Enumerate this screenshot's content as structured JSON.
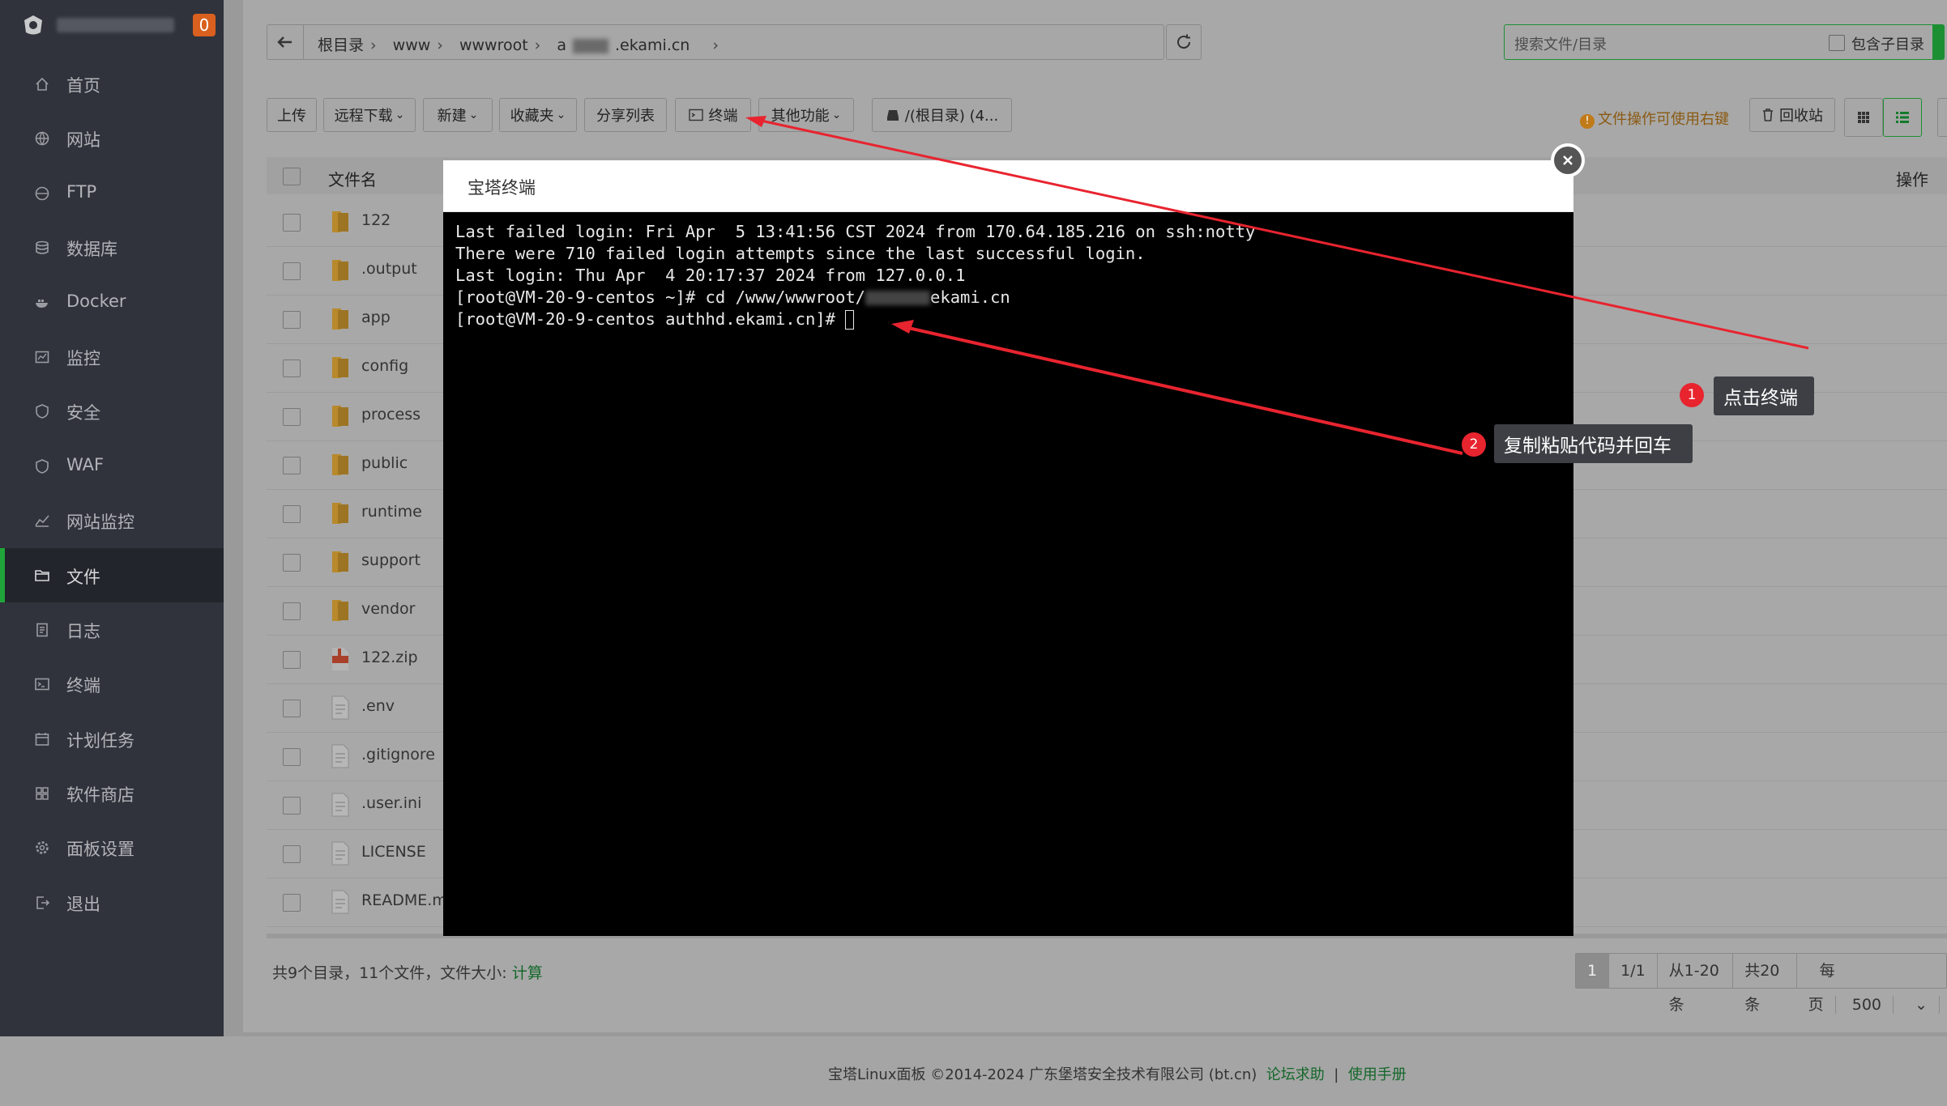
{
  "sidebar": {
    "badge": "0",
    "items": [
      {
        "label": "首页",
        "icon": "home-icon"
      },
      {
        "label": "网站",
        "icon": "globe-icon"
      },
      {
        "label": "FTP",
        "icon": "ftp-icon"
      },
      {
        "label": "数据库",
        "icon": "database-icon"
      },
      {
        "label": "Docker",
        "icon": "docker-icon"
      },
      {
        "label": "监控",
        "icon": "monitor-icon"
      },
      {
        "label": "安全",
        "icon": "shield-icon"
      },
      {
        "label": "WAF",
        "icon": "waf-shield-icon"
      },
      {
        "label": "网站监控",
        "icon": "chart-line-icon"
      },
      {
        "label": "文件",
        "icon": "folder-icon"
      },
      {
        "label": "日志",
        "icon": "log-icon"
      },
      {
        "label": "终端",
        "icon": "terminal-icon"
      },
      {
        "label": "计划任务",
        "icon": "calendar-icon"
      },
      {
        "label": "软件商店",
        "icon": "apps-icon"
      },
      {
        "label": "面板设置",
        "icon": "gear-icon"
      },
      {
        "label": "退出",
        "icon": "logout-icon"
      }
    ]
  },
  "path": {
    "crumbs": [
      "根目录",
      "www",
      "wwwroot",
      "a",
      ".ekami.cn"
    ]
  },
  "search": {
    "placeholder": "搜索文件/目录",
    "include_sub": "包含子目录"
  },
  "toolbar": {
    "upload": "上传",
    "remote_download": "远程下载",
    "new": "新建",
    "favorites": "收藏夹",
    "share_list": "分享列表",
    "terminal": "终端",
    "other": "其他功能",
    "disk": "/(根目录) (4...",
    "tip": "文件操作可使用右键",
    "recycle": "回收站"
  },
  "table": {
    "col_name": "文件名",
    "col_op": "操作",
    "rows": [
      {
        "name": "122",
        "type": "folder"
      },
      {
        "name": ".output",
        "type": "folder"
      },
      {
        "name": "app",
        "type": "folder"
      },
      {
        "name": "config",
        "type": "folder"
      },
      {
        "name": "process",
        "type": "folder"
      },
      {
        "name": "public",
        "type": "folder"
      },
      {
        "name": "runtime",
        "type": "folder"
      },
      {
        "name": "support",
        "type": "folder"
      },
      {
        "name": "vendor",
        "type": "folder"
      },
      {
        "name": "122.zip",
        "type": "zip"
      },
      {
        "name": ".env",
        "type": "file"
      },
      {
        "name": ".gitignore",
        "type": "file"
      },
      {
        "name": ".user.ini",
        "type": "file"
      },
      {
        "name": "LICENSE",
        "type": "file"
      },
      {
        "name": "README.md",
        "type": "file"
      }
    ]
  },
  "summary": {
    "text": "共9个目录，11个文件，文件大小:",
    "calc": "计算"
  },
  "pager": {
    "current": "1",
    "pages": "1/1",
    "range": "从1-20条",
    "total": "共20条",
    "per_page_label": "每页",
    "per_page": "500"
  },
  "copyright": {
    "text": "宝塔Linux面板 ©2014-2024 广东堡塔安全技术有限公司 (bt.cn)",
    "forum": "论坛求助",
    "sep": "|",
    "manual": "使用手册"
  },
  "modal": {
    "title": "宝塔终端",
    "lines": [
      "Last failed login: Fri Apr  5 13:41:56 CST 2024 from 170.64.185.216 on ssh:notty",
      "There were 710 failed login attempts since the last successful login.",
      "Last login: Thu Apr  4 20:17:37 2024 from 127.0.0.1"
    ],
    "cmd_prefix": "[root@VM-20-9-centos ~]# cd /www/wwwroot/",
    "cmd_suffix": "ekami.cn",
    "prompt": "[root@VM-20-9-centos authhd.ekami.cn]# "
  },
  "callouts": {
    "step1_num": "1",
    "step1": "点击终端",
    "step2_num": "2",
    "step2": "复制粘贴代码并回车"
  },
  "colors": {
    "accent_green": "#20a53a",
    "annotation_red": "#e8242f",
    "sidebar_bg": "#30333b"
  }
}
